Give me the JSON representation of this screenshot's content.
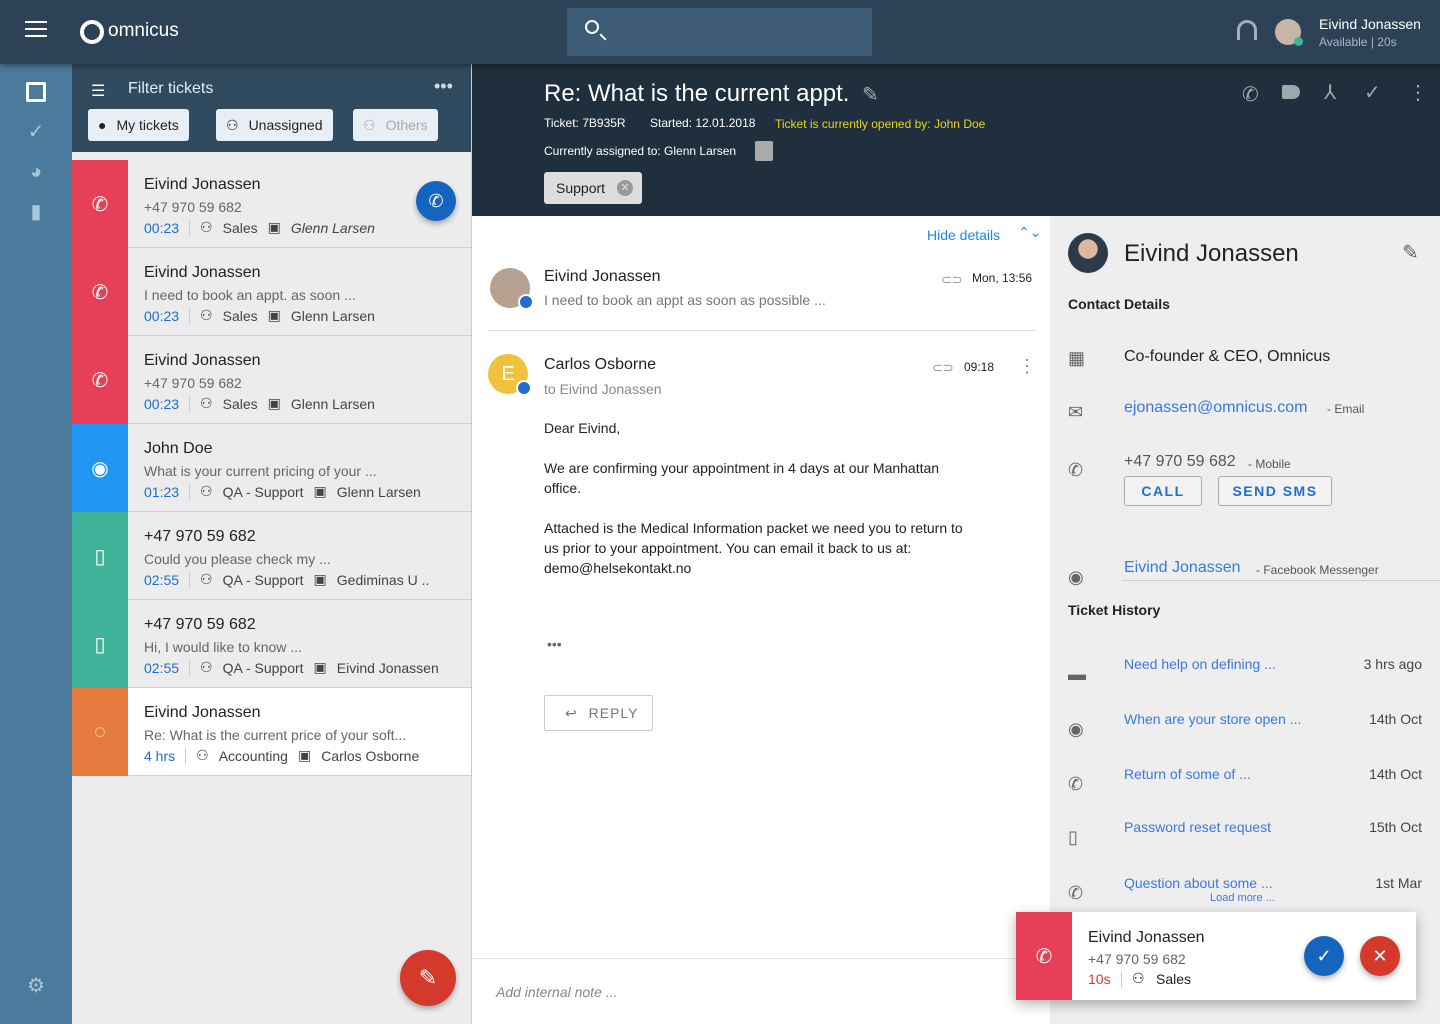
{
  "app": {
    "brand": "omnicus",
    "user_name": "Eivind Jonassen",
    "user_status": "Available | 20s"
  },
  "filter": {
    "title": "Filter tickets",
    "chips": [
      "My tickets",
      "Unassigned",
      "Others"
    ]
  },
  "tickets": [
    {
      "name": "Eivind Jonassen",
      "sub": "+47  970 59 682",
      "time": "00:23",
      "group": "Sales",
      "agent": "Glenn Larsen",
      "color": "#e63f57",
      "icon": "phone-incoming"
    },
    {
      "name": "Eivind Jonassen",
      "sub": "I need to book an appt. as soon ...",
      "time": "00:23",
      "group": "Sales",
      "agent": "Glenn Larsen",
      "color": "#e63f57",
      "icon": "phone-incoming"
    },
    {
      "name": "Eivind Jonassen",
      "sub": "+47  970 59 682",
      "time": "00:23",
      "group": "Sales",
      "agent": "Glenn Larsen",
      "color": "#e63f57",
      "icon": "phone-incoming"
    },
    {
      "name": "John Doe",
      "sub": "What is your current pricing of your  ...",
      "time": "01:23",
      "group": "QA - Support",
      "agent": "Glenn Larsen",
      "color": "#2196f3",
      "icon": "messenger"
    },
    {
      "name": "+47 970 59 682",
      "sub": "Could you please check my ...",
      "time": "02:55",
      "group": "QA - Support",
      "agent": "Gediminas U ..",
      "color": "#3fb39a",
      "icon": "mobile"
    },
    {
      "name": "+47 970 59 682",
      "sub": "Hi, I would like to know ...",
      "time": "02:55",
      "group": "QA - Support",
      "agent": "Eivind Jonassen",
      "color": "#3fb39a",
      "icon": "mobile"
    },
    {
      "name": "Eivind Jonassen",
      "sub": "Re: What is the current price of your soft...",
      "time": "4 hrs",
      "group": "Accounting",
      "agent": "Carlos Osborne",
      "color": "#e57b3e",
      "icon": "omnicus"
    }
  ],
  "ticket": {
    "title": "Re: What is the current appt.",
    "id": "Ticket: 7B935R",
    "started": "Started: 12.01.2018",
    "opened_by": "Ticket is currently opened by: John Doe",
    "assigned": "Currently assigned to:  Glenn Larsen",
    "tag": "Support"
  },
  "conversation": {
    "hide_details": "Hide details",
    "messages": [
      {
        "from": "Eivind Jonassen",
        "preview": "I need to book an appt as soon as possible ...",
        "time": "Mon, 13:56"
      },
      {
        "from": "Carlos Osborne",
        "to": "to Eivind Jonassen",
        "time": "09:18",
        "avatar_letter": "E",
        "body": [
          "Dear Eivind,",
          "We are confirming your appointment in 4 days at our Manhattan office.",
          "Attached is the Medical Information packet we need you to return to us prior to your appointment. You can email it back to us at: demo@helsekontakt.no"
        ]
      }
    ],
    "reply": "REPLY",
    "note_placeholder": "Add internal note ..."
  },
  "contact": {
    "name": "Eivind Jonassen",
    "section": "Contact Details",
    "company": "Co-founder & CEO, Omnicus",
    "email": "ejonassen@omnicus.com",
    "email_label": "- Email",
    "phone": "+47 970 59 682",
    "phone_label": "- Mobile",
    "call": "CALL",
    "sms": "SEND SMS",
    "messenger": "Eivind Jonassen",
    "messenger_label": "- Facebook Messenger"
  },
  "history": {
    "title": "Ticket History",
    "load_more": "Load more ...",
    "items": [
      {
        "title": "Need help on defining ...",
        "date": "3 hrs ago"
      },
      {
        "title": "When are your store open ...",
        "date": "14th Oct"
      },
      {
        "title": "Return of some of ...",
        "date": "14th Oct"
      },
      {
        "title": "Password reset request",
        "date": "15th Oct"
      },
      {
        "title": "Question about some ...",
        "date": "1st Mar"
      }
    ]
  },
  "incoming": {
    "name": "Eivind Jonassen",
    "phone": "+47  970 59 682",
    "time": "10s",
    "group": "Sales"
  }
}
